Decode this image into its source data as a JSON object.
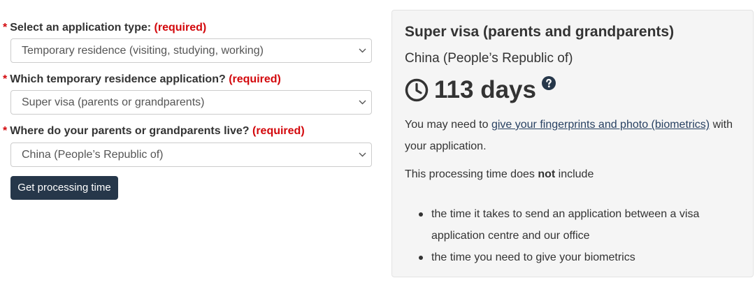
{
  "form": {
    "fields": [
      {
        "label": "Select an application type:",
        "required_marker": "*",
        "required_text": "(required)",
        "selected": "Temporary residence (visiting, studying, working)"
      },
      {
        "label": "Which temporary residence application?",
        "required_marker": "*",
        "required_text": "(required)",
        "selected": "Super visa (parents or grandparents)"
      },
      {
        "label": "Where do your parents or grandparents live?",
        "required_marker": "*",
        "required_text": "(required)",
        "selected": "China (People’s Republic of)"
      }
    ],
    "submit_label": "Get processing time"
  },
  "result": {
    "title": "Super visa (parents and grandparents)",
    "country": "China (People’s Republic of)",
    "processing_time": "113 days",
    "biometrics_prefix": "You may need to",
    "biometrics_link": "give your fingerprints and photo (biometrics)",
    "biometrics_suffix": "with your application.",
    "exclusion_prefix": "This processing time does",
    "exclusion_emphasis": "not",
    "exclusion_suffix": "include",
    "exclusions": [
      "the time it takes to send an application between a visa application centre and our office",
      "the time you need to give your biometrics"
    ]
  },
  "colors": {
    "required": "#d3080c",
    "button_bg": "#26374a",
    "link": "#284162",
    "panel_bg": "#f5f5f5"
  },
  "icons": {
    "select_arrow": "chevron-down-icon",
    "clock": "clock-icon",
    "help": "question-circle-icon"
  }
}
